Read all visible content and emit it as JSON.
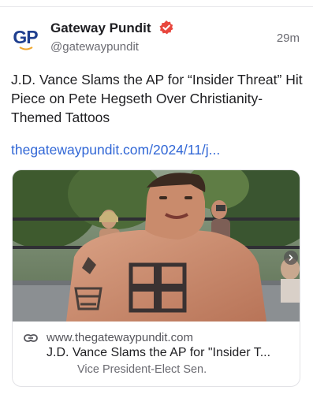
{
  "post": {
    "author_name": "Gateway Pundit",
    "handle": "@gatewaypundit",
    "time": "29m",
    "avatar_text": "GP",
    "text": "J.D. Vance Slams the AP for “Insider Threat” Hit Piece on Pete Hegseth Over Christianity-Themed Tattoos",
    "link": "thegatewaypundit.com/2024/11/j..."
  },
  "card": {
    "domain": "www.thegatewaypundit.com",
    "title": "J.D. Vance Slams the AP for \"Insider T...",
    "description": "Vice President-Elect Sen."
  },
  "icons": {
    "verified": "verified-badge-icon",
    "link": "link-icon",
    "next": "chevron-right-icon"
  },
  "colors": {
    "link": "#3167d6",
    "verified": "#e8463d",
    "logo_blue": "#1f3f8f",
    "logo_orange": "#f0a62d"
  }
}
